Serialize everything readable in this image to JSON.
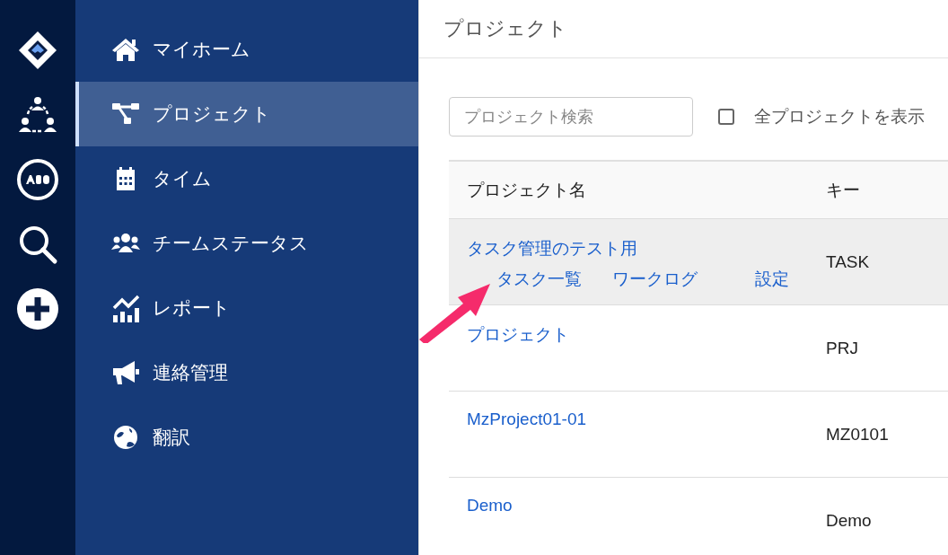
{
  "sidebar": {
    "items": [
      {
        "label": "マイホーム",
        "kind": "home",
        "selected": false
      },
      {
        "label": "プロジェクト",
        "kind": "tree",
        "selected": true
      },
      {
        "label": "タイム",
        "kind": "calendar",
        "selected": false
      },
      {
        "label": "チームステータス",
        "kind": "team",
        "selected": false
      },
      {
        "label": "レポート",
        "kind": "chart",
        "selected": false
      },
      {
        "label": "連絡管理",
        "kind": "megaphone",
        "selected": false
      },
      {
        "label": "翻訳",
        "kind": "globe",
        "selected": false
      }
    ]
  },
  "page_title": "プロジェクト",
  "search": {
    "placeholder": "プロジェクト検索"
  },
  "show_all": {
    "label": "全プロジェクトを表示",
    "checked": false
  },
  "table": {
    "columns": [
      "プロジェクト名",
      "キー"
    ],
    "rows": [
      {
        "name": "タスク管理のテスト用",
        "key": "TASK",
        "selected": true,
        "links": [
          "タスク一覧",
          "ワークログ",
          "設定"
        ]
      },
      {
        "name": "プロジェクト",
        "key": "PRJ",
        "selected": false
      },
      {
        "name": "MzProject01-01",
        "key": "MZ0101",
        "selected": false
      },
      {
        "name": "Demo",
        "key": "Demo",
        "selected": false
      }
    ]
  }
}
